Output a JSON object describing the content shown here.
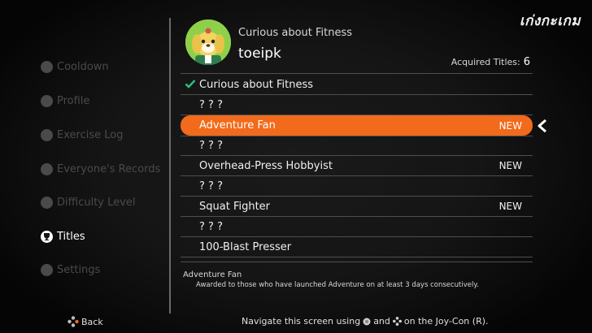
{
  "watermark": "เก่งกะเกม",
  "sidebar": {
    "items": [
      {
        "label": "Cooldown",
        "icon": "cooldown-icon",
        "active": false
      },
      {
        "label": "Profile",
        "icon": "profile-icon",
        "active": false
      },
      {
        "label": "Exercise Log",
        "icon": "exercise-log-icon",
        "active": false
      },
      {
        "label": "Everyone's Records",
        "icon": "globe-icon",
        "active": false
      },
      {
        "label": "Difficulty Level",
        "icon": "difficulty-icon",
        "active": false
      },
      {
        "label": "Titles",
        "icon": "trophy-icon",
        "active": true
      },
      {
        "label": "Settings",
        "icon": "gear-icon",
        "active": false
      }
    ]
  },
  "profile": {
    "subtitle": "Curious about Fitness",
    "name": "toeipk",
    "acquired_label": "Acquired Titles:",
    "acquired_count": "6"
  },
  "titles": [
    {
      "label": "Curious about Fitness",
      "badge": "",
      "checked": true,
      "selected": false
    },
    {
      "label": "? ? ?",
      "badge": "",
      "checked": false,
      "selected": false
    },
    {
      "label": "Adventure Fan",
      "badge": "NEW",
      "checked": false,
      "selected": true
    },
    {
      "label": "? ? ?",
      "badge": "",
      "checked": false,
      "selected": false
    },
    {
      "label": "Overhead-Press Hobbyist",
      "badge": "NEW",
      "checked": false,
      "selected": false
    },
    {
      "label": "? ? ?",
      "badge": "",
      "checked": false,
      "selected": false
    },
    {
      "label": "Squat Fighter",
      "badge": "NEW",
      "checked": false,
      "selected": false
    },
    {
      "label": "? ? ?",
      "badge": "",
      "checked": false,
      "selected": false
    },
    {
      "label": "100-Blast Presser",
      "badge": "",
      "checked": false,
      "selected": false
    }
  ],
  "description": {
    "title": "Adventure Fan",
    "text": "Awarded to those who have launched Adventure on at least 3 days consecutively."
  },
  "footer": {
    "back_label": "Back",
    "nav_text_before": "Navigate this screen using",
    "nav_text_and": "and",
    "nav_text_after": "on the Joy-Con (R)."
  },
  "colors": {
    "accent": "#f26a1b",
    "check": "#2fc07a",
    "inactive": "#4a4a4a"
  }
}
